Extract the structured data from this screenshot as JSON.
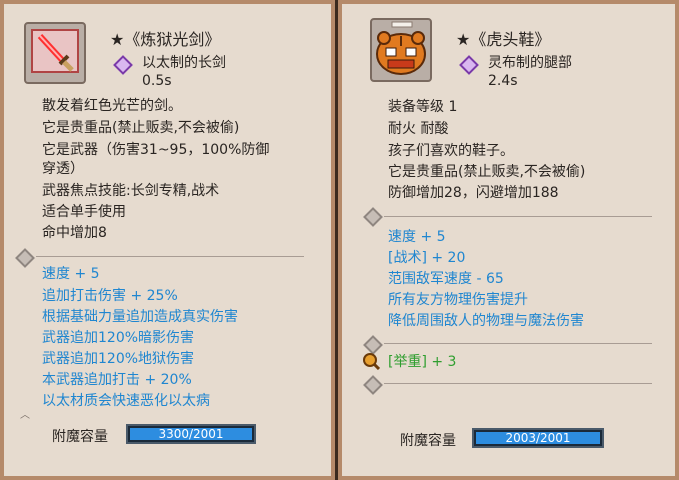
{
  "left": {
    "name": "★《炼狱光剑》",
    "material": "以太制的长剑",
    "speed": "0.5s",
    "desc": [
      "散发着红色光芒的剑。",
      "它是贵重品(禁止贩卖,不会被偷)",
      "它是武器（伤害31~95，100%防御",
      "穿透）",
      "武器焦点技能:长剑专精,战术",
      "适合单手使用",
      "命中增加8"
    ],
    "enchants": [
      "速度 + 5",
      "追加打击伤害 + 25%",
      "根据基础力量追加造成真实伤害",
      "武器追加120%暗影伤害",
      "武器追加120%地狱伤害",
      "本武器追加打击 + 20%",
      "以太材质会快速恶化以太病"
    ],
    "capacity_label": "附魔容量",
    "capacity_text": "3300/2001",
    "capacity_fill": 1.0
  },
  "right": {
    "name": "★《虎头鞋》",
    "material": "灵布制的腿部",
    "speed": "2.4s",
    "desc": [
      "装备等级 1",
      "耐火 耐酸",
      "孩子们喜欢的鞋子。",
      "它是贵重品(禁止贩卖,不会被偷)",
      "防御增加28，闪避增加188"
    ],
    "enchants": [
      "速度 + 5",
      "[战术] + 20",
      "范围敌军速度 - 65",
      "所有友方物理伤害提升",
      "降低周围敌人的物理与魔法伤害"
    ],
    "skill": "[举重] + 3",
    "capacity_label": "附魔容量",
    "capacity_text": "2003/2001",
    "capacity_fill": 1.0
  }
}
